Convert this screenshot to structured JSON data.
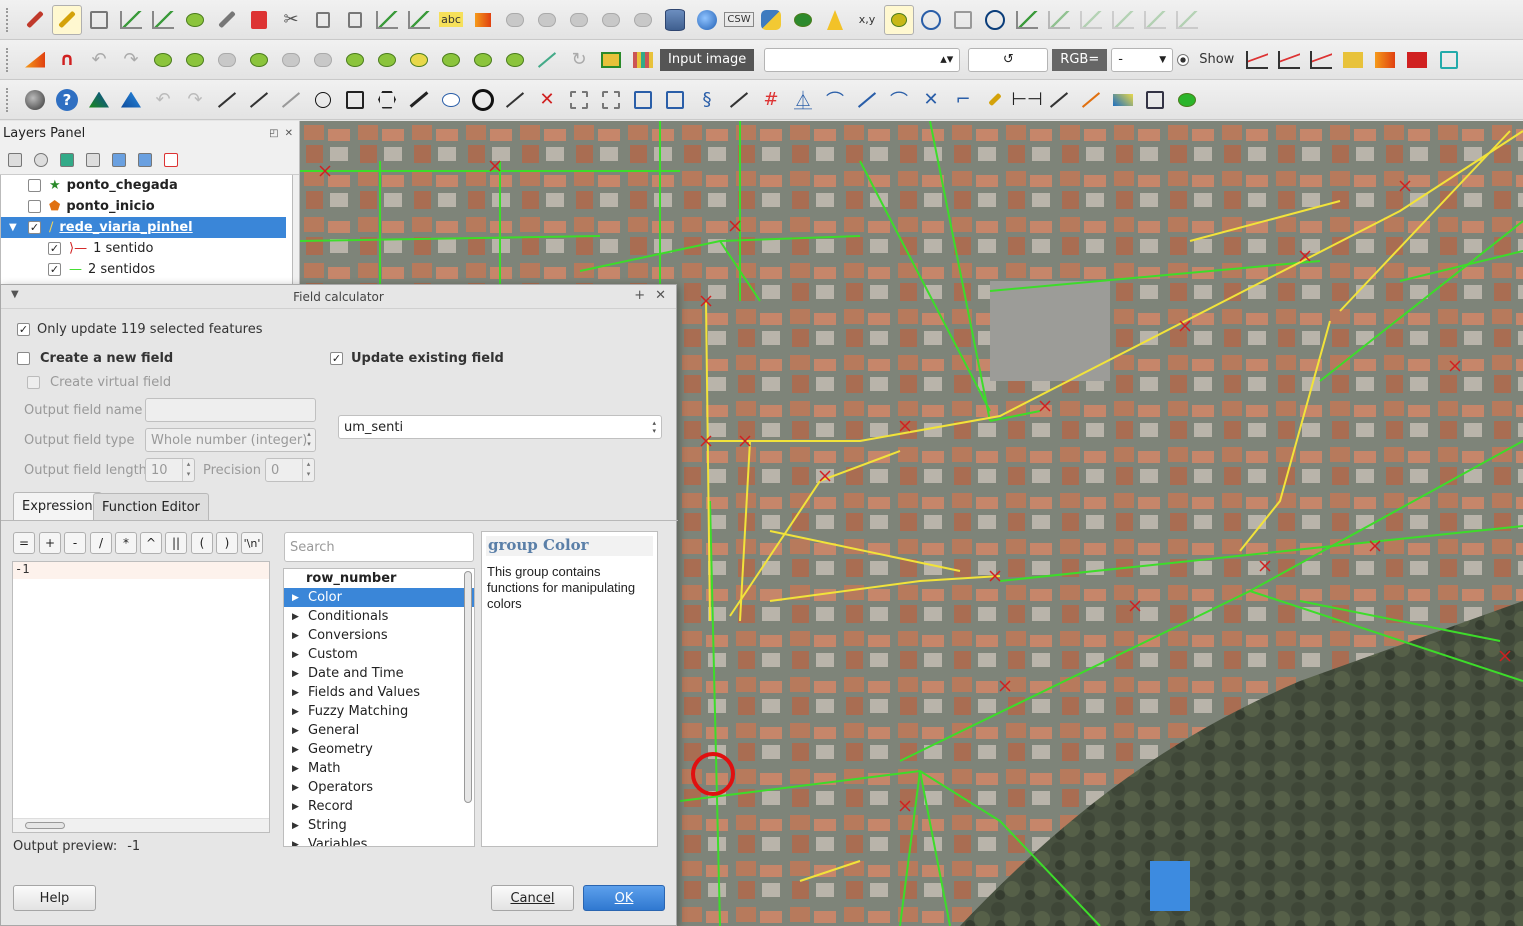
{
  "toolbar1": {
    "labels": {
      "abc1": "abc",
      "csw": "CSW",
      "xy": "x,y"
    }
  },
  "toolbar2": {
    "image_label": "Input image",
    "refresh": "↺",
    "rgb_label": "RGB=",
    "rgb_value": "-",
    "show_label": "Show"
  },
  "layers_panel": {
    "title": "Layers Panel",
    "layers": [
      {
        "name": "ponto_chegada",
        "checked": false
      },
      {
        "name": "ponto_inicio",
        "checked": false
      },
      {
        "name": "rede_viaria_pinhel",
        "checked": true
      }
    ],
    "sublayers": [
      {
        "name": "1 sentido",
        "checked": true
      },
      {
        "name": "2 sentidos",
        "checked": true
      }
    ]
  },
  "dialog": {
    "title": "Field calculator",
    "only_update": "Only update 119 selected features",
    "create_new": "Create a new field",
    "create_virtual": "Create virtual field",
    "update_existing": "Update existing field",
    "output_name_label": "Output field name",
    "output_name_value": "",
    "output_type_label": "Output field type",
    "output_type_value": "Whole number (integer)",
    "output_length_label": "Output field length",
    "output_length_value": "10",
    "precision_label": "Precision",
    "precision_value": "0",
    "existing_field": "um_senti",
    "tab_expression": "Expression",
    "tab_function_editor": "Function Editor",
    "operators": [
      "=",
      "+",
      "-",
      "/",
      "*",
      "^",
      "||",
      "(",
      ")",
      "'\\n'"
    ],
    "expression": "-1",
    "search_placeholder": "Search",
    "function_groups": [
      "row_number",
      "Color",
      "Conditionals",
      "Conversions",
      "Custom",
      "Date and Time",
      "Fields and Values",
      "Fuzzy Matching",
      "General",
      "Geometry",
      "Math",
      "Operators",
      "Record",
      "String",
      "Variables"
    ],
    "selected_group": "Color",
    "help_title": "group Color",
    "help_text": "This group contains functions for manipulating colors",
    "output_preview_label": "Output preview:",
    "output_preview_value": "-1",
    "help_button": "Help",
    "cancel_button": "Cancel",
    "ok_button": "OK"
  },
  "colors": {
    "selection": "#3a86d8",
    "road_two_way": "#3ddc2a",
    "road_one_way": "#f2e33a",
    "vertex": "#d21f1f"
  }
}
